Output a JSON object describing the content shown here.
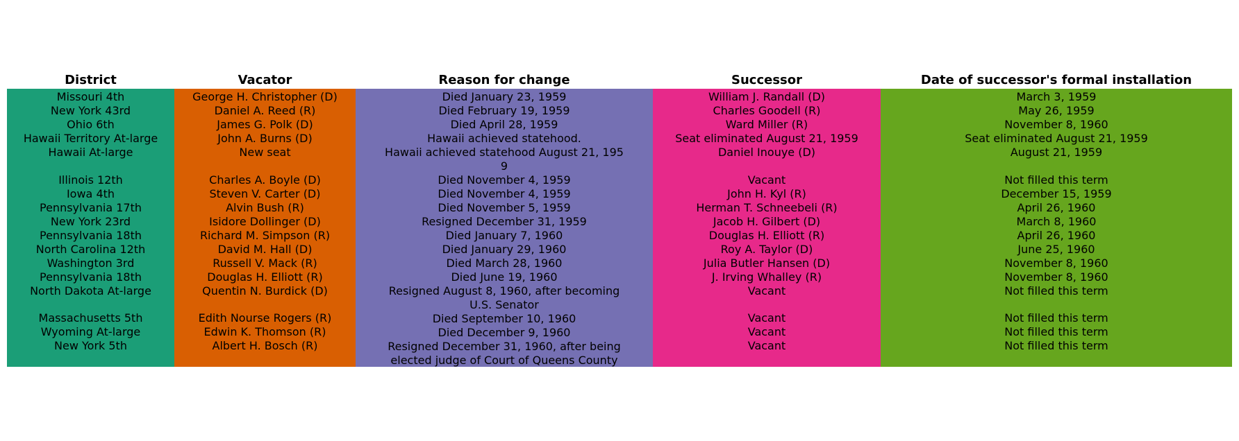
{
  "chart_data": {
    "type": "table",
    "columns": [
      {
        "header": "District",
        "color": "#1b9e77"
      },
      {
        "header": "Vacator",
        "color": "#d95f02"
      },
      {
        "header": "Reason for change",
        "color": "#7570b3"
      },
      {
        "header": "Successor",
        "color": "#e7298a"
      },
      {
        "header": "Date of successor's formal installation",
        "color": "#66a61e"
      }
    ],
    "rows": [
      [
        "Missouri 4th",
        "George H. Christopher (D)",
        "Died January 23, 1959",
        "William J. Randall (D)",
        "March 3, 1959"
      ],
      [
        "New York 43rd",
        "Daniel A. Reed (R)",
        "Died February 19, 1959",
        "Charles Goodell (R)",
        "May 26, 1959"
      ],
      [
        "Ohio 6th",
        "James G. Polk (D)",
        "Died April 28, 1959",
        "Ward Miller (R)",
        "November 8, 1960"
      ],
      [
        "Hawaii Territory At-large",
        "John A. Burns (D)",
        "Hawaii achieved statehood.",
        "Seat eliminated August 21, 1959",
        "Seat eliminated August 21, 1959"
      ],
      [
        "Hawaii At-large",
        "New seat",
        "Hawaii achieved statehood August 21, 195\n9",
        "Daniel Inouye (D)",
        "August 21, 1959"
      ],
      [
        "Illinois 12th",
        "Charles A. Boyle (D)",
        "Died November 4, 1959",
        "Vacant",
        "Not filled this term"
      ],
      [
        "Iowa 4th",
        "Steven V. Carter (D)",
        "Died November 4, 1959",
        "John H. Kyl (R)",
        "December 15, 1959"
      ],
      [
        "Pennsylvania 17th",
        "Alvin Bush (R)",
        "Died November 5, 1959",
        "Herman T. Schneebeli (R)",
        "April 26, 1960"
      ],
      [
        "New York 23rd",
        "Isidore Dollinger (D)",
        "Resigned December 31, 1959",
        "Jacob H. Gilbert (D)",
        "March 8, 1960"
      ],
      [
        "Pennsylvania 18th",
        "Richard M. Simpson (R)",
        "Died January 7, 1960",
        "Douglas H. Elliott (R)",
        "April 26, 1960"
      ],
      [
        "North Carolina 12th",
        "David M. Hall (D)",
        "Died January 29, 1960",
        "Roy A. Taylor (D)",
        "June 25, 1960"
      ],
      [
        "Washington 3rd",
        "Russell V. Mack (R)",
        "Died March 28, 1960",
        "Julia Butler Hansen (D)",
        "November 8, 1960"
      ],
      [
        "Pennsylvania 18th",
        "Douglas H. Elliott (R)",
        "Died June 19, 1960",
        "J. Irving Whalley (R)",
        "November 8, 1960"
      ],
      [
        "North Dakota At-large",
        "Quentin N. Burdick (D)",
        "Resigned August 8, 1960, after becoming\nU.S. Senator",
        "Vacant",
        "Not filled this term"
      ],
      [
        "Massachusetts 5th",
        "Edith Nourse Rogers (R)",
        "Died September 10, 1960",
        "Vacant",
        "Not filled this term"
      ],
      [
        "Wyoming At-large",
        "Edwin K. Thomson (R)",
        "Died December 9, 1960",
        "Vacant",
        "Not filled this term"
      ],
      [
        "New York 5th",
        "Albert H. Bosch (R)",
        "Resigned December 31, 1960, after being\nelected judge of Court of Queens County",
        "Vacant",
        "Not filled this term"
      ]
    ]
  }
}
